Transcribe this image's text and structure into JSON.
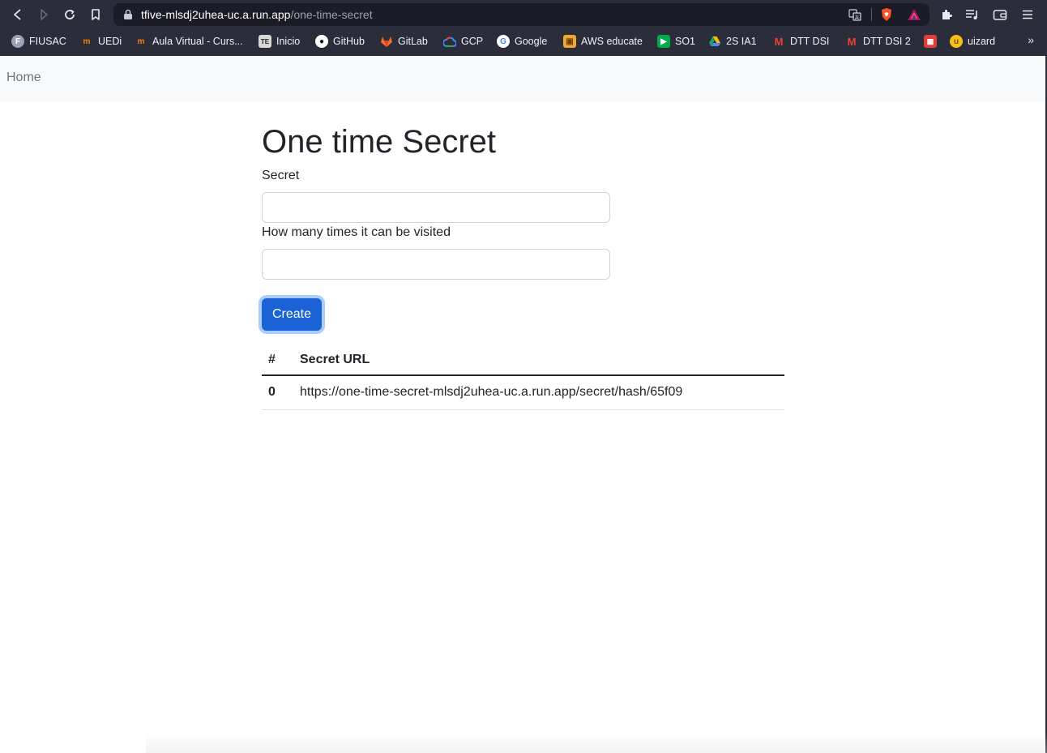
{
  "browser": {
    "url_host": "tfive-mlsdj2uhea-uc.a.run.app",
    "url_path": "/one-time-secret",
    "bookmarks": [
      {
        "label": "FIUSAC",
        "icon": "fiusac-icon",
        "color": "#9aa0b5"
      },
      {
        "label": "UEDi",
        "icon": "moodle-icon",
        "color": "#f98012"
      },
      {
        "label": "Aula Virtual - Curs...",
        "icon": "moodle-icon",
        "color": "#f98012"
      },
      {
        "label": "Inicio",
        "icon": "terminal-icon",
        "color": "#d8d8d8"
      },
      {
        "label": "GitHub",
        "icon": "github-icon",
        "color": "#ffffff"
      },
      {
        "label": "GitLab",
        "icon": "gitlab-icon",
        "color": "#fc6d26"
      },
      {
        "label": "GCP",
        "icon": "gcp-icon",
        "color": "#4285f4"
      },
      {
        "label": "Google",
        "icon": "google-icon",
        "color": "#ffffff"
      },
      {
        "label": "AWS educate",
        "icon": "aws-box-icon",
        "color": "#f0a830"
      },
      {
        "label": "SO1",
        "icon": "meet-icon",
        "color": "#00ac47"
      },
      {
        "label": "2S IA1",
        "icon": "drive-icon",
        "color": "#1fa463"
      },
      {
        "label": "DTT DSI",
        "icon": "gmail-icon",
        "color": "#ea4335"
      },
      {
        "label": "DTT DSI 2",
        "icon": "gmail-icon",
        "color": "#ea4335"
      },
      {
        "label": "",
        "icon": "clapper-icon",
        "color": "#e03c3c"
      },
      {
        "label": "uizard",
        "icon": "uizard-icon",
        "color": "#f6c117"
      }
    ],
    "more_bookmarks": "»"
  },
  "navbar": {
    "home_label": "Home"
  },
  "page": {
    "title": "One time Secret",
    "secret_label": "Secret",
    "secret_value": "",
    "visits_label": "How many times it can be visited",
    "visits_value": "",
    "create_label": "Create",
    "table": {
      "headers": [
        "#",
        "Secret URL"
      ],
      "rows": [
        {
          "index": "0",
          "url": "https://one-time-secret-mlsdj2uhea-uc.a.run.app/secret/hash/65f09"
        }
      ]
    }
  },
  "colors": {
    "chrome_bg": "#2b2d3a",
    "navbar_bg": "#f8f9fa",
    "primary": "#1a62d6"
  }
}
